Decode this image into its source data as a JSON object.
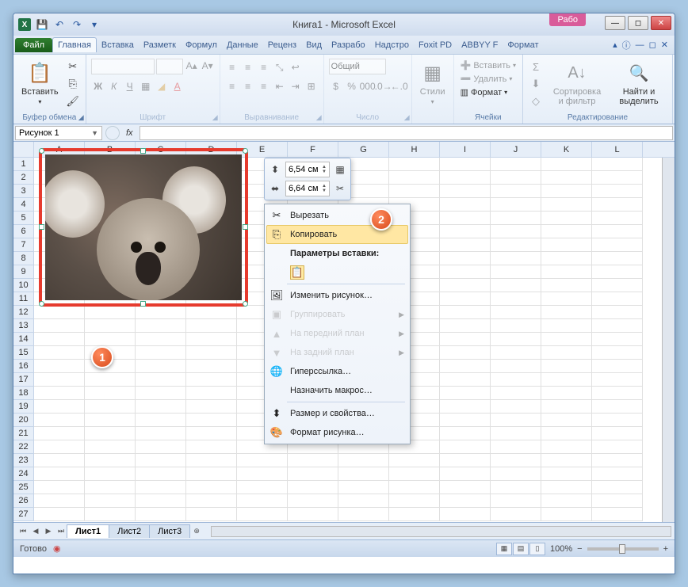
{
  "titlebar": {
    "title": "Книга1 - Microsoft Excel",
    "rabo": "Рабо"
  },
  "tabs": {
    "file": "Файл",
    "items": [
      "Главная",
      "Вставка",
      "Разметк",
      "Формул",
      "Данные",
      "Реценз",
      "Вид",
      "Разрабо",
      "Надстро",
      "Foxit PD",
      "ABBYY F",
      "Формат"
    ],
    "active": 0
  },
  "ribbon": {
    "clipboard": {
      "paste": "Вставить",
      "label": "Буфер обмена"
    },
    "font": {
      "label": "Шрифт"
    },
    "align": {
      "label": "Выравнивание"
    },
    "number": {
      "format": "Общий",
      "label": "Число"
    },
    "styles": {
      "btn": "Стили"
    },
    "cells": {
      "insert": "Вставить",
      "delete": "Удалить",
      "format": "Формат",
      "label": "Ячейки"
    },
    "editing": {
      "sort": "Сортировка и фильтр",
      "find": "Найти и выделить",
      "label": "Редактирование"
    }
  },
  "namebox": "Рисунок 1",
  "fx_label": "fx",
  "columns": [
    "A",
    "B",
    "C",
    "D",
    "E",
    "F",
    "G",
    "H",
    "I",
    "J",
    "K",
    "L"
  ],
  "rows": 27,
  "mini": {
    "h": "6,54 см",
    "w": "6,64 см"
  },
  "ctx": {
    "cut": "Вырезать",
    "copy": "Копировать",
    "paste_opts": "Параметры вставки:",
    "change_pic": "Изменить рисунок…",
    "group": "Группировать",
    "front": "На передний план",
    "back": "На задний план",
    "hyperlink": "Гиперссылка…",
    "macro": "Назначить макрос…",
    "size": "Размер и свойства…",
    "format": "Формат рисунка…"
  },
  "badges": {
    "one": "1",
    "two": "2"
  },
  "sheets": [
    "Лист1",
    "Лист2",
    "Лист3"
  ],
  "status": {
    "ready": "Готово",
    "zoom": "100%"
  }
}
